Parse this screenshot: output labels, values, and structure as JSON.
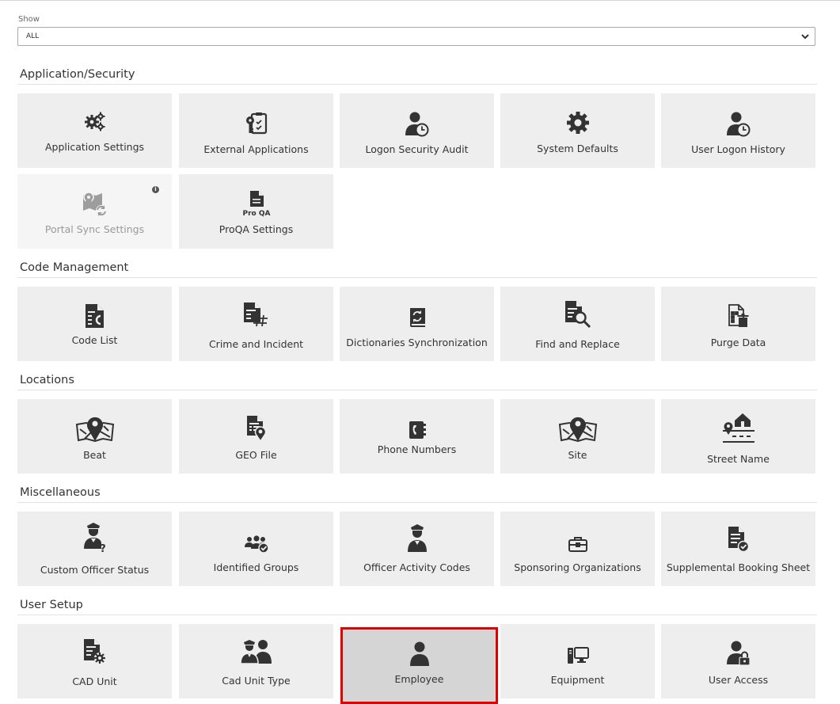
{
  "filter": {
    "label": "Show",
    "selected": "ALL"
  },
  "sections": {
    "application_security": {
      "title": "Application/Security",
      "tiles": [
        {
          "label": "Application Settings",
          "icon": "gears-icon"
        },
        {
          "label": "External Applications",
          "icon": "app-key-icon"
        },
        {
          "label": "Logon Security Audit",
          "icon": "user-clock-icon"
        },
        {
          "label": "System Defaults",
          "icon": "gear-icon"
        },
        {
          "label": "User Logon History",
          "icon": "user-clock-icon"
        },
        {
          "label": "Portal Sync Settings",
          "icon": "map-sync-icon",
          "disabled": true,
          "info": "i"
        },
        {
          "label": "ProQA Settings",
          "icon": "proqa-document-icon",
          "badge": "Pro QA"
        }
      ]
    },
    "code_management": {
      "title": "Code Management",
      "tiles": [
        {
          "label": "Code List",
          "icon": "document-code-icon"
        },
        {
          "label": "Crime and Incident",
          "icon": "document-hash-icon"
        },
        {
          "label": "Dictionaries Synchronization",
          "icon": "book-sync-icon"
        },
        {
          "label": "Find and Replace",
          "icon": "document-search-icon"
        },
        {
          "label": "Purge Data",
          "icon": "document-trash-icon"
        }
      ]
    },
    "locations": {
      "title": "Locations",
      "tiles": [
        {
          "label": "Beat",
          "icon": "map-pin-icon"
        },
        {
          "label": "GEO File",
          "icon": "document-pin-icon"
        },
        {
          "label": "Phone Numbers",
          "icon": "phonebook-icon"
        },
        {
          "label": "Site",
          "icon": "map-pin-icon"
        },
        {
          "label": "Street Name",
          "icon": "house-street-icon"
        }
      ]
    },
    "miscellaneous": {
      "title": "Miscellaneous",
      "tiles": [
        {
          "label": "Custom Officer Status",
          "icon": "officer-question-icon"
        },
        {
          "label": "Identified Groups",
          "icon": "group-check-icon"
        },
        {
          "label": "Officer Activity Codes",
          "icon": "officer-icon"
        },
        {
          "label": "Sponsoring Organizations",
          "icon": "briefcase-icon"
        },
        {
          "label": "Supplemental Booking Sheet",
          "icon": "document-check-icon"
        }
      ]
    },
    "user_setup": {
      "title": "User Setup",
      "tiles": [
        {
          "label": "CAD Unit",
          "icon": "document-gear-icon"
        },
        {
          "label": "Cad Unit Type",
          "icon": "officers-icon"
        },
        {
          "label": "Employee",
          "icon": "user-icon",
          "selected": true
        },
        {
          "label": "Equipment",
          "icon": "computer-icon"
        },
        {
          "label": "User Access",
          "icon": "user-lock-icon"
        }
      ]
    }
  },
  "colors": {
    "tile_bg": "#eeeeee",
    "icon": "#333333",
    "selected_border": "#e00000"
  }
}
